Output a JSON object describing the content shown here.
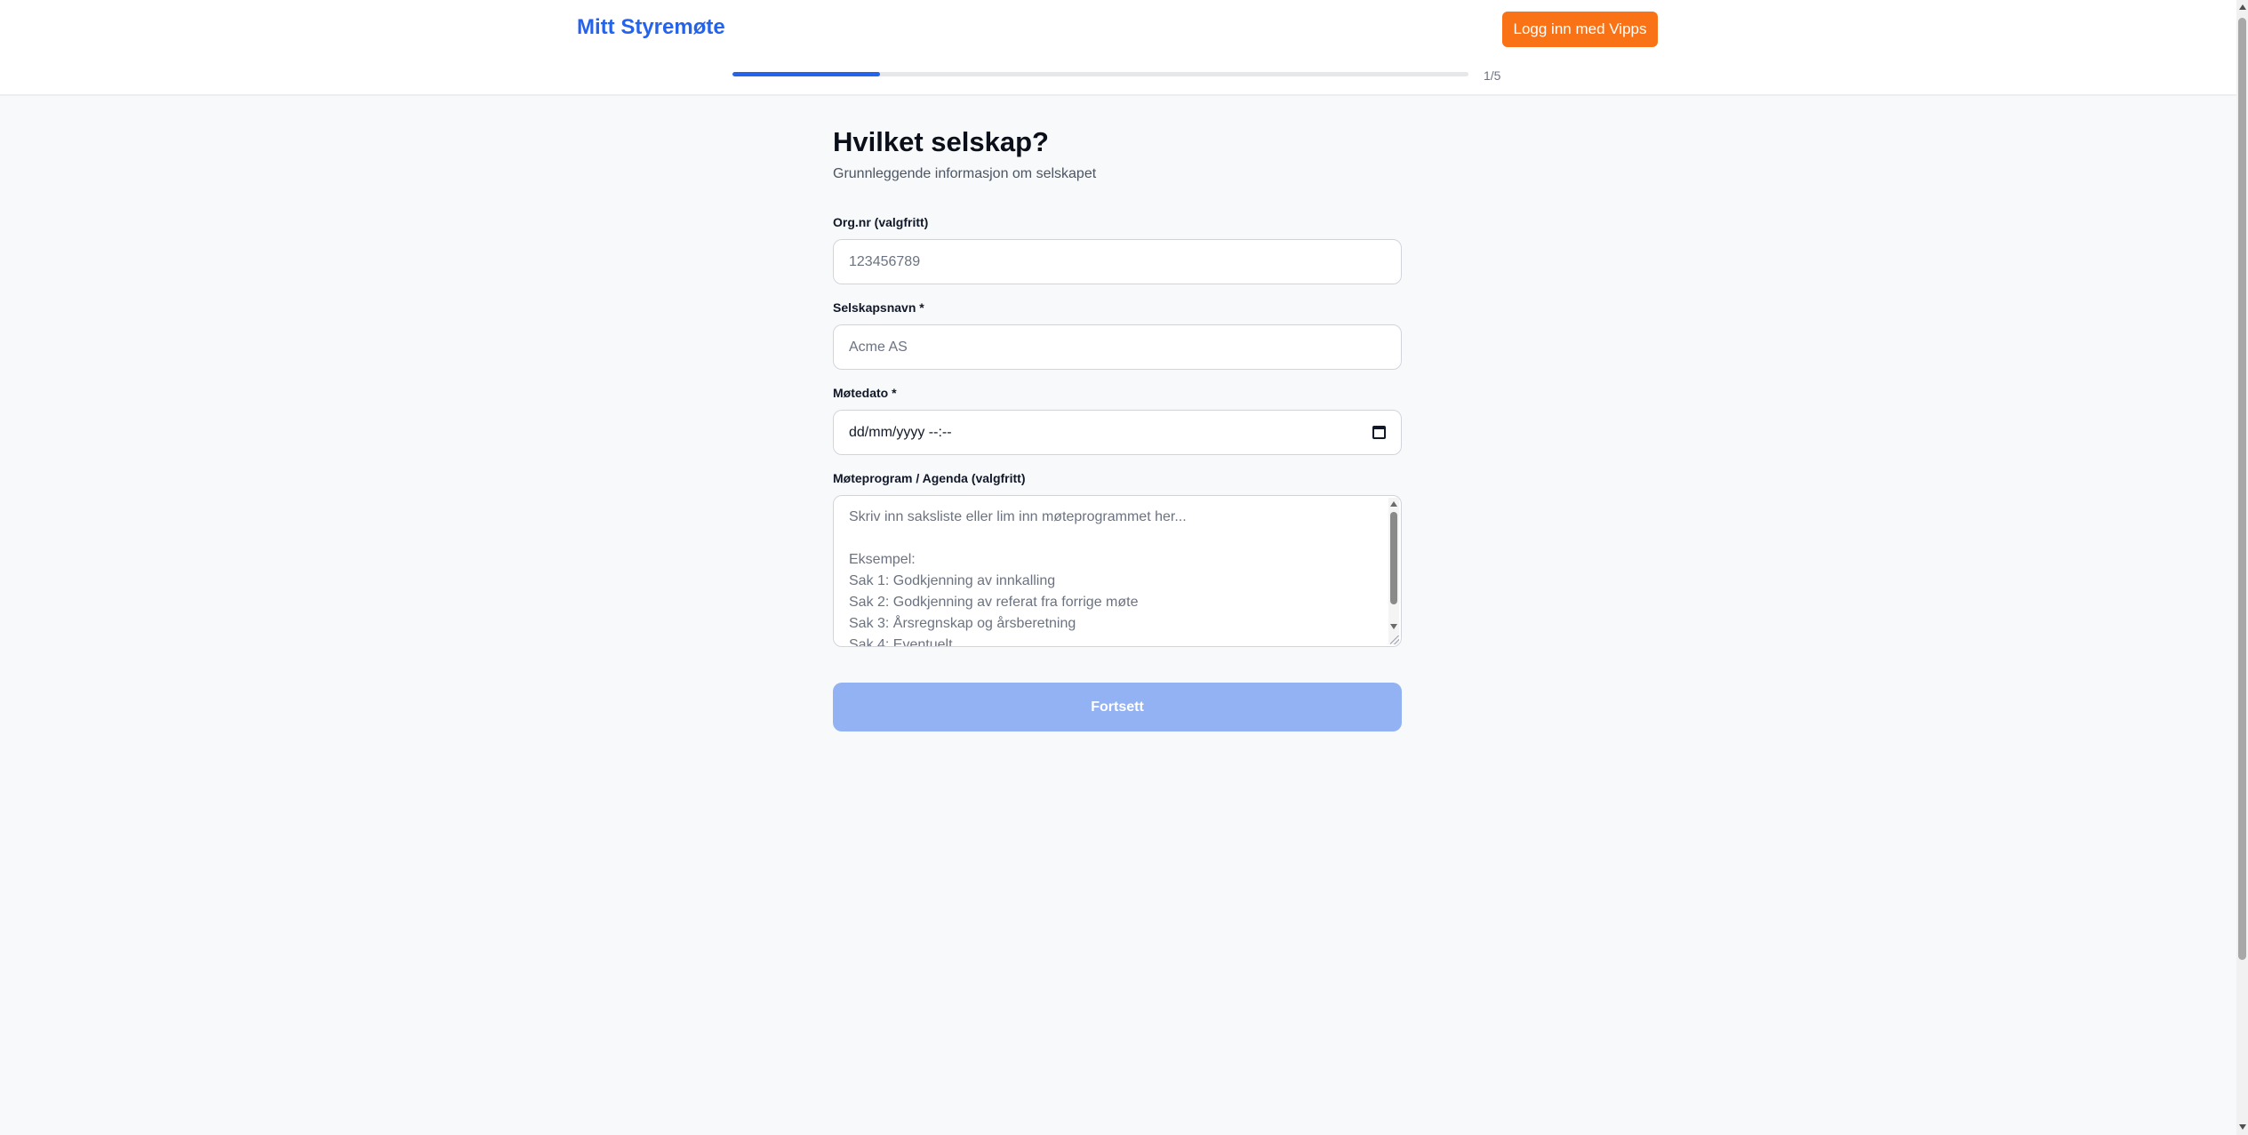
{
  "header": {
    "brand": "Mitt Styremøte",
    "login_button": "Logg inn med Vipps",
    "login_button_color": "#f97316",
    "brand_color": "#2563eb"
  },
  "progress": {
    "label": "1/5",
    "fraction": 0.2
  },
  "form": {
    "title": "Hvilket selskap?",
    "subtitle": "Grunnleggende informasjon om selskapet",
    "org_nr": {
      "label": "Org.nr (valgfritt)",
      "placeholder": "123456789"
    },
    "company_name": {
      "label": "Selskapsnavn *",
      "placeholder": "Acme AS"
    },
    "meeting_date": {
      "label": "Møtedato *",
      "placeholder": "dd/mm/yyyy --:--"
    },
    "agenda": {
      "label": "Møteprogram / Agenda (valgfritt)",
      "placeholder_lines": [
        "Skriv inn saksliste eller lim inn møteprogrammet her...",
        "",
        "Eksempel:",
        "Sak 1: Godkjenning av innkalling",
        "Sak 2: Godkjenning av referat fra forrige møte",
        "Sak 3: Årsregnskap og årsberetning",
        "Sak 4: Eventuelt"
      ]
    },
    "submit_button": "Fortsett"
  }
}
